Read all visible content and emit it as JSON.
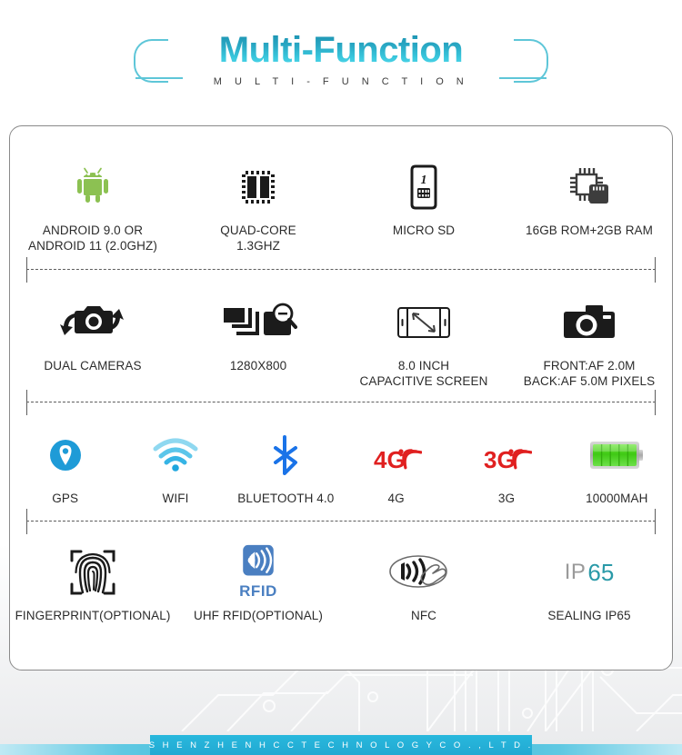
{
  "header": {
    "title": "Multi-Function",
    "subtitle": "M U L T I - F U N C T I O N",
    "bracket_color": "#5ec6d8",
    "title_gradient_top": "#1a8fae",
    "title_gradient_bottom": "#59dced"
  },
  "footer": {
    "company": "S H E N Z H E N   H C C   T E C H N O L O G Y   C O . ,   L T D .",
    "banner_color": "#22a9d2"
  },
  "features": {
    "rows": [
      {
        "cells": [
          {
            "icon": "android-icon",
            "label": "ANDROID 9.0 OR\nANDROID 11 (2.0GHZ)"
          },
          {
            "icon": "cpu-quadcore-icon",
            "label": "QUAD-CORE\n1.3GHZ"
          },
          {
            "icon": "micro-sd-card-icon",
            "label": "MICRO SD"
          },
          {
            "icon": "memory-chip-icon",
            "label": "16GB ROM+2GB RAM"
          }
        ]
      },
      {
        "cells": [
          {
            "icon": "dual-camera-icon",
            "label": "DUAL CAMERAS"
          },
          {
            "icon": "image-resolution-icon",
            "label": "1280X800"
          },
          {
            "icon": "screen-size-icon",
            "label": "8.0 INCH\nCAPACITIVE SCREEN"
          },
          {
            "icon": "camera-icon",
            "label": "FRONT:AF 2.0M\nBACK:AF 5.0M PIXELS"
          }
        ]
      },
      {
        "cells": [
          {
            "icon": "gps-pin-icon",
            "label": "GPS"
          },
          {
            "icon": "wifi-icon",
            "label": "WIFI"
          },
          {
            "icon": "bluetooth-icon",
            "label": "BLUETOOTH 4.0"
          },
          {
            "icon": "4g-signal-icon",
            "label": "4G",
            "icon_text": "4G"
          },
          {
            "icon": "3g-signal-icon",
            "label": "3G",
            "icon_text": "3G"
          },
          {
            "icon": "battery-icon",
            "label": "10000MAH"
          }
        ]
      },
      {
        "cells": [
          {
            "icon": "fingerprint-icon",
            "label": "FINGERPRINT(OPTIONAL)"
          },
          {
            "icon": "rfid-icon",
            "label": "UHF RFID(OPTIONAL)",
            "icon_text": "RFID"
          },
          {
            "icon": "nfc-icon",
            "label": "NFC"
          },
          {
            "icon": "ip65-rating-icon",
            "label": "SEALING IP65",
            "icon_text": "IP",
            "icon_text_2": "65"
          }
        ]
      }
    ]
  },
  "colors": {
    "android_green": "#8cc152",
    "gps_blue": "#1e9bd7",
    "wifi_blue": "#3fb8e8",
    "bluetooth_blue": "#1a73e8",
    "signal_red": "#e02020",
    "battery_green": "#49d62a",
    "rfid_blue": "#4a7fc1",
    "ip_teal": "#2a9aa8",
    "card_border": "#8a8a8a",
    "text": "#2b2b2b"
  }
}
